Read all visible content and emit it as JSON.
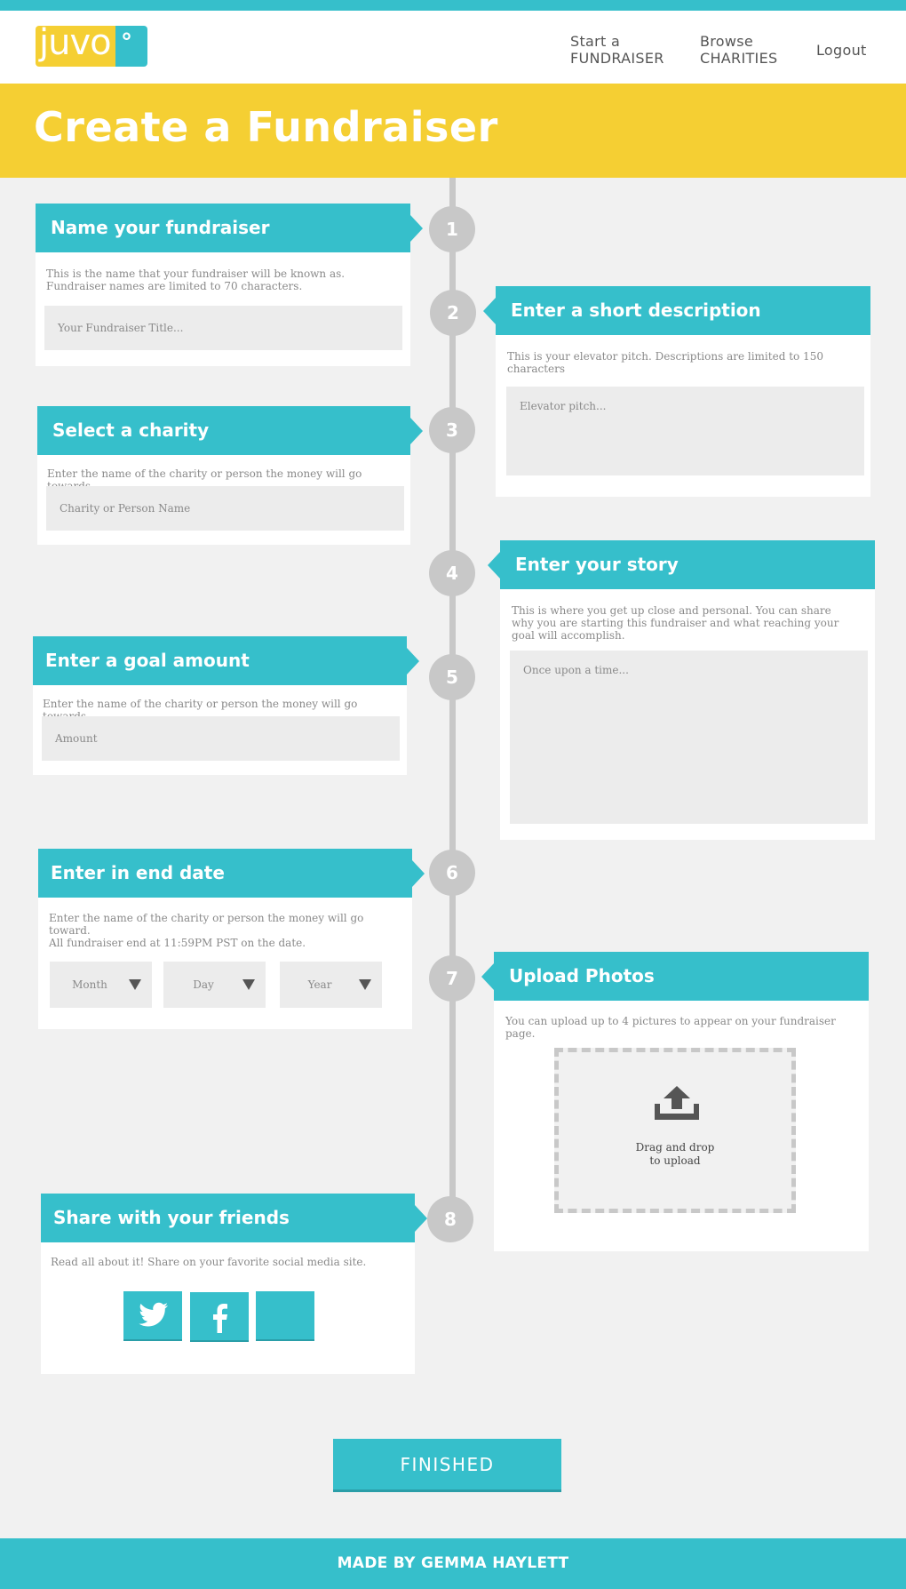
{
  "header": {
    "logo_text": "juvo",
    "nav": {
      "start_line1": "Start a",
      "start_line2": "FUNDRAISER",
      "browse_line1": "Browse",
      "browse_line2": "CHARITIES",
      "logout": "Logout"
    }
  },
  "banner": {
    "title": "Create a Fundraiser"
  },
  "steps": [
    "1",
    "2",
    "3",
    "4",
    "5",
    "6",
    "7",
    "8"
  ],
  "name_card": {
    "heading": "Name your fundraiser",
    "description": "This is the name that your fundraiser will be known as. Fundraiser names are limited to 70 characters.",
    "placeholder": "Your Fundraiser Title..."
  },
  "description_card": {
    "heading": "Enter a short description",
    "description": "This is your elevator pitch. Descriptions are limited to 150 characters",
    "placeholder": "Elevator pitch..."
  },
  "charity_card": {
    "heading": "Select a charity",
    "description": "Enter the name of the charity or person the money will go towards",
    "placeholder": "Charity or Person Name"
  },
  "story_card": {
    "heading": "Enter your story",
    "description": "This is where you get up close and personal. You can share why you are starting this fundraiser and what reaching your goal will accomplish.",
    "placeholder": "Once upon a time..."
  },
  "goal_card": {
    "heading": "Enter a goal amount",
    "description": "Enter the name of the charity or person the money will go towards",
    "placeholder": "Amount"
  },
  "end_date_card": {
    "heading": "Enter in end date",
    "description_line1": "Enter the name of the charity or person the money will go toward.",
    "description_line2": "All fundraiser end at 11:59PM PST on the date.",
    "month": "Month",
    "day": "Day",
    "year": "Year"
  },
  "photos_card": {
    "heading": "Upload Photos",
    "description": "You can upload up to 4 pictures to appear on your fundraiser page.",
    "drop_line1": "Drag and drop",
    "drop_line2": "to upload"
  },
  "share_card": {
    "heading": "Share with your friends",
    "description": "Read all about it! Share on your favorite social media site."
  },
  "icons": [
    "upload-icon",
    "twitter-icon",
    "facebook-icon"
  ],
  "finished_label": "FINISHED",
  "footer_text": "MADE BY GEMMA HAYLETT",
  "colors": {
    "teal": "#36bfcb",
    "yellow": "#f5cf33",
    "background": "#f1f1f1",
    "timeline": "#c8c8c8"
  }
}
